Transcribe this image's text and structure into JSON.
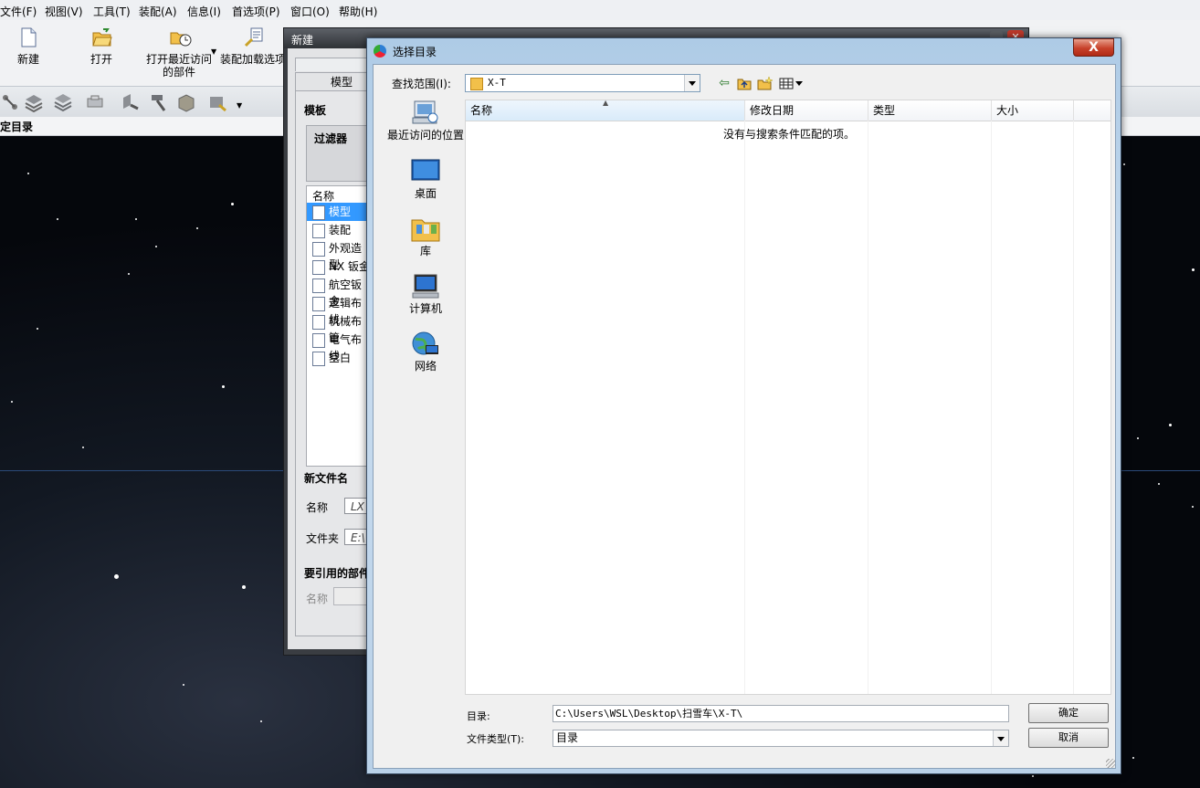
{
  "menubar": {
    "items": [
      "文件(F)",
      "视图(V)",
      "工具(T)",
      "装配(A)",
      "信息(I)",
      "首选项(P)",
      "窗口(O)",
      "帮助(H)"
    ]
  },
  "toolbar": {
    "new_label": "新建",
    "open_label": "打开",
    "recent_label_1": "打开最近访问",
    "recent_label_2": "的部件",
    "load_label": "装配加载选项"
  },
  "nav_title": "定目录",
  "new_dialog": {
    "title": "新建",
    "tab_model": "模型",
    "template_header": "模板",
    "filter_label": "过滤器",
    "name_col": "名称",
    "templates": [
      "模型",
      "装配",
      "外观造型",
      "NX 钣金",
      "航空钣金",
      "逻辑布线",
      "机械布管",
      "电气布线",
      "空白"
    ],
    "new_file_header": "新文件名",
    "name_label": "名称",
    "name_value": "LX",
    "folder_label": "文件夹",
    "folder_value": "E:\\",
    "ref_header": "要引用的部件",
    "ref_name_label": "名称"
  },
  "select_dialog": {
    "title": "选择目录",
    "close_icon_text": "X",
    "look_in_label": "查找范围(I):",
    "look_in_value": "X-T",
    "places": [
      "最近访问的位置",
      "桌面",
      "库",
      "计算机",
      "网络"
    ],
    "columns": [
      "名称",
      "修改日期",
      "类型",
      "大小"
    ],
    "empty_message": "没有与搜索条件匹配的项。",
    "dir_label": "目录:",
    "dir_value": "C:\\Users\\WSL\\Desktop\\扫雪车\\X-T\\",
    "type_label": "文件类型(T):",
    "type_value": "目录",
    "ok_label": "确定",
    "cancel_label": "取消"
  }
}
